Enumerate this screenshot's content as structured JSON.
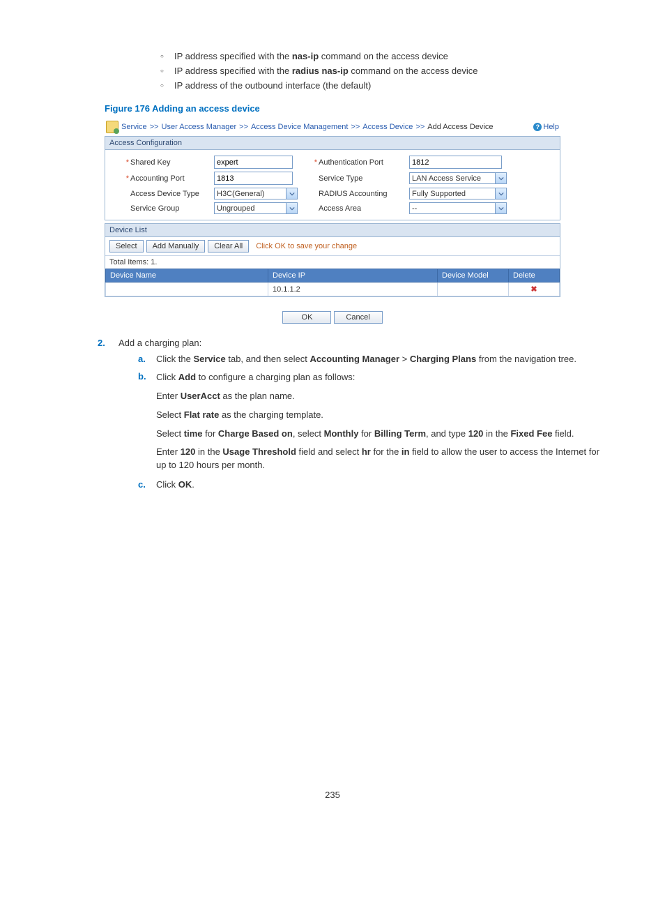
{
  "bullets": [
    {
      "pre": "IP address specified with the ",
      "bold": "nas-ip",
      "post": " command on the access device"
    },
    {
      "pre": "IP address specified with the ",
      "bold": "radius nas-ip",
      "post": " command on the access device"
    },
    {
      "pre": "IP address of the outbound interface (the default)",
      "bold": "",
      "post": ""
    }
  ],
  "figure_caption": "Figure 176 Adding an access device",
  "crumbs": {
    "c1": "Service",
    "c2": "User Access Manager",
    "c3": "Access Device Management",
    "c4": "Access Device",
    "c5": "Add Access Device",
    "sep": ">>",
    "help": "Help"
  },
  "panel1": {
    "title": "Access Configuration"
  },
  "form": {
    "shared_key": {
      "label": "Shared Key",
      "value": "expert",
      "required": "*"
    },
    "auth_port": {
      "label": "Authentication Port",
      "value": "1812",
      "required": "*"
    },
    "acct_port": {
      "label": "Accounting Port",
      "value": "1813",
      "required": "*"
    },
    "svc_type": {
      "label": "Service Type",
      "value": "LAN Access Service"
    },
    "dev_type": {
      "label": "Access Device Type",
      "value": "H3C(General)"
    },
    "radius_acct": {
      "label": "RADIUS Accounting",
      "value": "Fully Supported"
    },
    "svc_group": {
      "label": "Service Group",
      "value": "Ungrouped"
    },
    "access_area": {
      "label": "Access Area",
      "value": "--"
    }
  },
  "panel2": {
    "title": "Device List"
  },
  "buttons": {
    "select": "Select",
    "add_manually": "Add Manually",
    "clear_all": "Clear All",
    "ok": "OK",
    "cancel": "Cancel"
  },
  "hint": "Click OK to save your change",
  "total": "Total Items: 1.",
  "table": {
    "h1": "Device Name",
    "h2": "Device IP",
    "h3": "Device Model",
    "h4": "Delete",
    "r1": {
      "name": "",
      "ip": "10.1.1.2",
      "model": ""
    }
  },
  "step": {
    "num": "2.",
    "text": "Add a charging plan:",
    "a": {
      "marker": "a.",
      "t1": "Click the ",
      "b1": "Service",
      "t2": " tab, and then select ",
      "b2": "Accounting Manager",
      "t3": " > ",
      "b3": "Charging Plans",
      "t4": " from the navigation tree."
    },
    "b": {
      "marker": "b.",
      "t1": "Click ",
      "b1": "Add",
      "t2": " to configure a charging plan as follows:",
      "p1": {
        "t1": "Enter ",
        "b1": "UserAcct",
        "t2": " as the plan name."
      },
      "p2": {
        "t1": "Select ",
        "b1": "Flat rate",
        "t2": " as the charging template."
      },
      "p3": {
        "t1": "Select ",
        "b1": "time",
        "t2": " for ",
        "b2": "Charge Based on",
        "t3": ", select ",
        "b3": "Monthly",
        "t4": " for ",
        "b4": "Billing Term",
        "t5": ", and type ",
        "b5": "120",
        "t6": " in the ",
        "b6": "Fixed Fee",
        "t7": " field."
      },
      "p4": {
        "t1": "Enter ",
        "b1": "120",
        "t2": " in the ",
        "b2": "Usage Threshold",
        "t3": " field and select ",
        "b3": "hr",
        "t4": " for the ",
        "b4": "in",
        "t5": " field to allow the user to access the Internet for up to 120 hours per month."
      }
    },
    "c": {
      "marker": "c.",
      "t1": "Click ",
      "b1": "OK",
      "t2": "."
    }
  },
  "pagenum": "235"
}
